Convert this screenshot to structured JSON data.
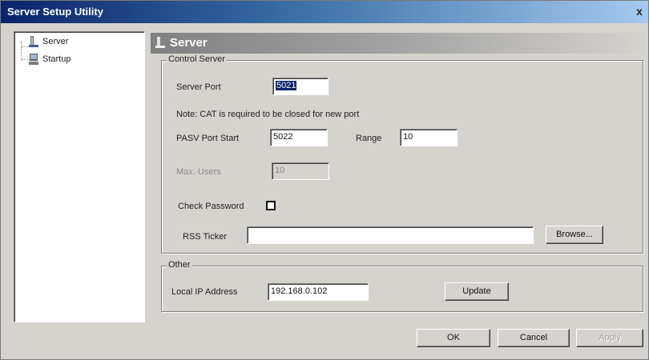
{
  "window": {
    "title": "Server Setup Utility",
    "close_glyph": "x"
  },
  "tree": {
    "items": [
      {
        "label": "Server",
        "icon": "server-icon"
      },
      {
        "label": "Startup",
        "icon": "startup-icon"
      }
    ]
  },
  "header": {
    "title": "Server"
  },
  "control_server": {
    "legend": "Control Server",
    "server_port_label": "Server Port",
    "server_port_value": "5021",
    "note": "Note: CAT is required to be closed  for new port",
    "pasv_start_label": "PASV Port Start",
    "pasv_start_value": "5022",
    "range_label": "Range",
    "range_value": "10",
    "max_users_label": "Max. Users",
    "max_users_value": "10",
    "check_password_label": "Check Password",
    "check_password_checked": false,
    "rss_label": "RSS Ticker",
    "rss_value": "",
    "browse_label": "Browse..."
  },
  "other": {
    "legend": "Other",
    "local_ip_label": "Local IP Address",
    "local_ip_value": "192.168.0.102",
    "update_label": "Update"
  },
  "footer": {
    "ok_label": "OK",
    "cancel_label": "Cancel",
    "apply_label": "Apply"
  }
}
